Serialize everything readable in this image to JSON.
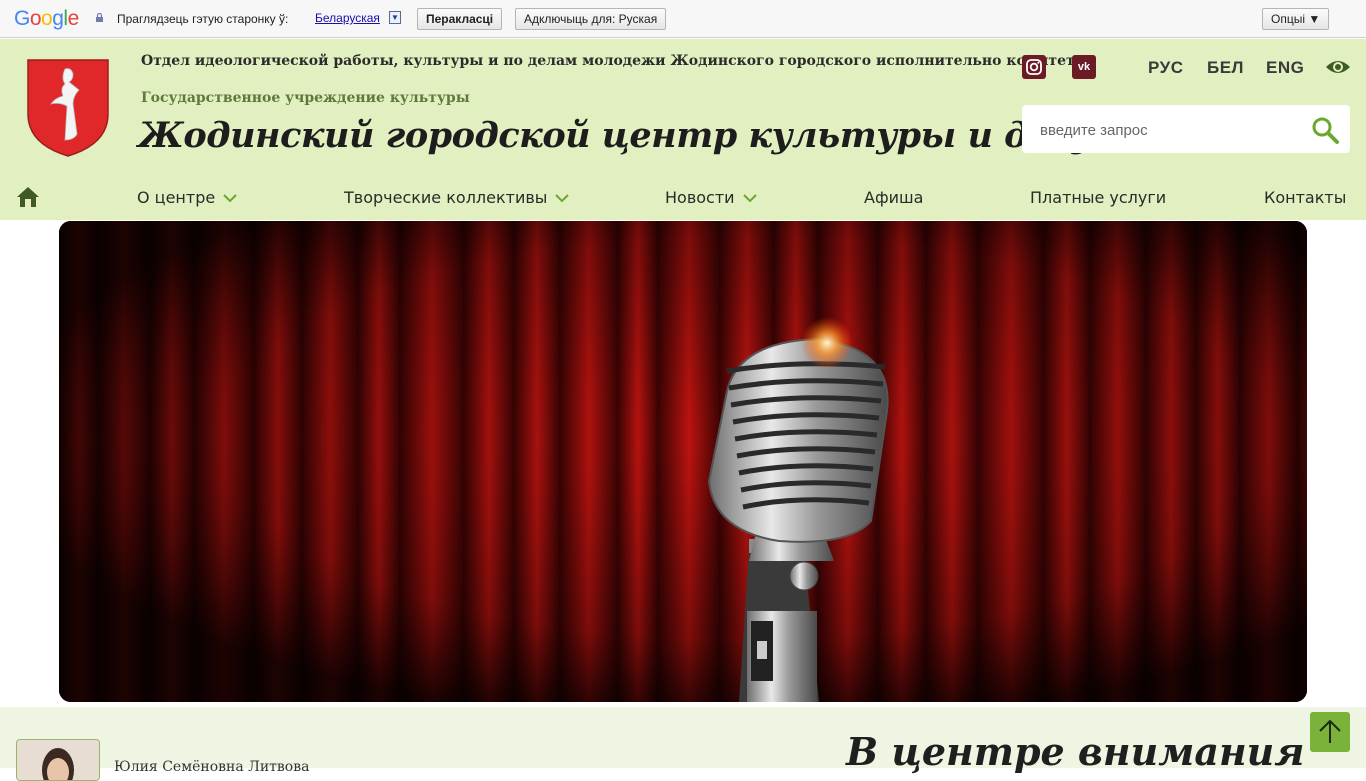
{
  "translate_bar": {
    "logo": "Google",
    "prompt": "Праглядзець гэтую старонку ў:",
    "language": "Беларуская",
    "language_arrow": "▼",
    "translate_button": "Перакласці",
    "disable_button": "Адключыць для: Руская",
    "options_button": "Опцыі ▼"
  },
  "header": {
    "department": "Отдел идеологической работы, культуры и по делам молодежи Жодинского городского исполнительно комитета",
    "institution": "Государственное учреждение культуры",
    "title": "Жодинский городской центр культуры и досуга",
    "social": {
      "instagram_icon": "instagram-icon",
      "vk_label": "vk"
    },
    "languages": [
      "РУС",
      "БЕЛ",
      "ENG"
    ],
    "eye_icon": "eye-icon",
    "search": {
      "placeholder": "введите запрос",
      "icon": "search-icon"
    }
  },
  "nav": {
    "home_icon": "home-icon",
    "items": [
      {
        "label": "О центре",
        "dropdown": true
      },
      {
        "label": "Творческие коллективы",
        "dropdown": true
      },
      {
        "label": "Новости",
        "dropdown": true
      },
      {
        "label": "Афиша",
        "dropdown": false
      },
      {
        "label": "Платные услуги",
        "dropdown": false
      },
      {
        "label": "Контакты",
        "dropdown": false
      }
    ]
  },
  "hero": {
    "image": "red-curtain-microphone"
  },
  "bottom": {
    "person_name": "Юлия Семёновна Литвова",
    "section_title": "В центре внимания",
    "scroll_top_icon": "arrow-up-icon"
  },
  "colors": {
    "header_bg": "#e2efc0",
    "accent_green": "#7bb23a",
    "social_bg": "#6b1b26",
    "coat_red": "#e0282b"
  }
}
